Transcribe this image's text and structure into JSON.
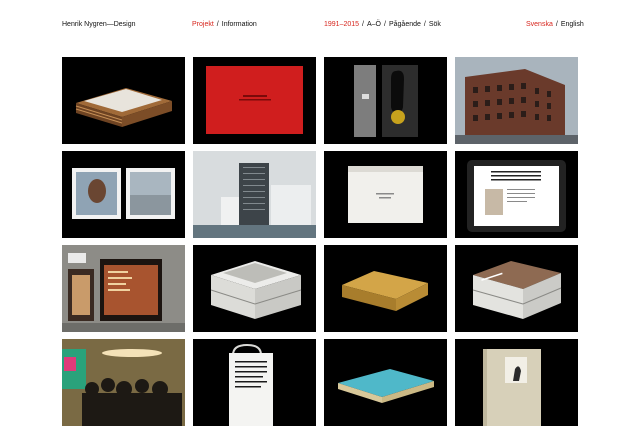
{
  "brand": "Henrik Nygren—Design",
  "nav": {
    "section_active": "Projekt",
    "section_other": "Information",
    "years": "1991–2015",
    "az": "A–Ö",
    "ongoing": "Pågående",
    "search": "Sök",
    "lang_active": "Svenska",
    "lang_other": "English"
  },
  "colors": {
    "accent": "#d7261e",
    "tile_bg": "#000000",
    "page_bg": "#ffffff"
  },
  "projects": [
    {
      "name": "project-tile-1",
      "thumb": "stacked-books-brown"
    },
    {
      "name": "project-tile-2",
      "thumb": "red-book-cover"
    },
    {
      "name": "project-tile-3",
      "thumb": "gray-box-with-object"
    },
    {
      "name": "project-tile-4",
      "thumb": "brick-building-photo"
    },
    {
      "name": "project-tile-5",
      "thumb": "two-photo-prints"
    },
    {
      "name": "project-tile-6",
      "thumb": "tower-waterfront-photo"
    },
    {
      "name": "project-tile-7",
      "thumb": "white-box"
    },
    {
      "name": "project-tile-8",
      "thumb": "tablet-website"
    },
    {
      "name": "project-tile-9",
      "thumb": "storefront-photo"
    },
    {
      "name": "project-tile-10",
      "thumb": "stacked-books-photo"
    },
    {
      "name": "project-tile-11",
      "thumb": "gold-box"
    },
    {
      "name": "project-tile-12",
      "thumb": "stacked-books-cover"
    },
    {
      "name": "project-tile-13",
      "thumb": "crowd-event-photo"
    },
    {
      "name": "project-tile-14",
      "thumb": "white-bag"
    },
    {
      "name": "project-tile-15",
      "thumb": "turquoise-book"
    },
    {
      "name": "project-tile-16",
      "thumb": "beige-book"
    }
  ]
}
